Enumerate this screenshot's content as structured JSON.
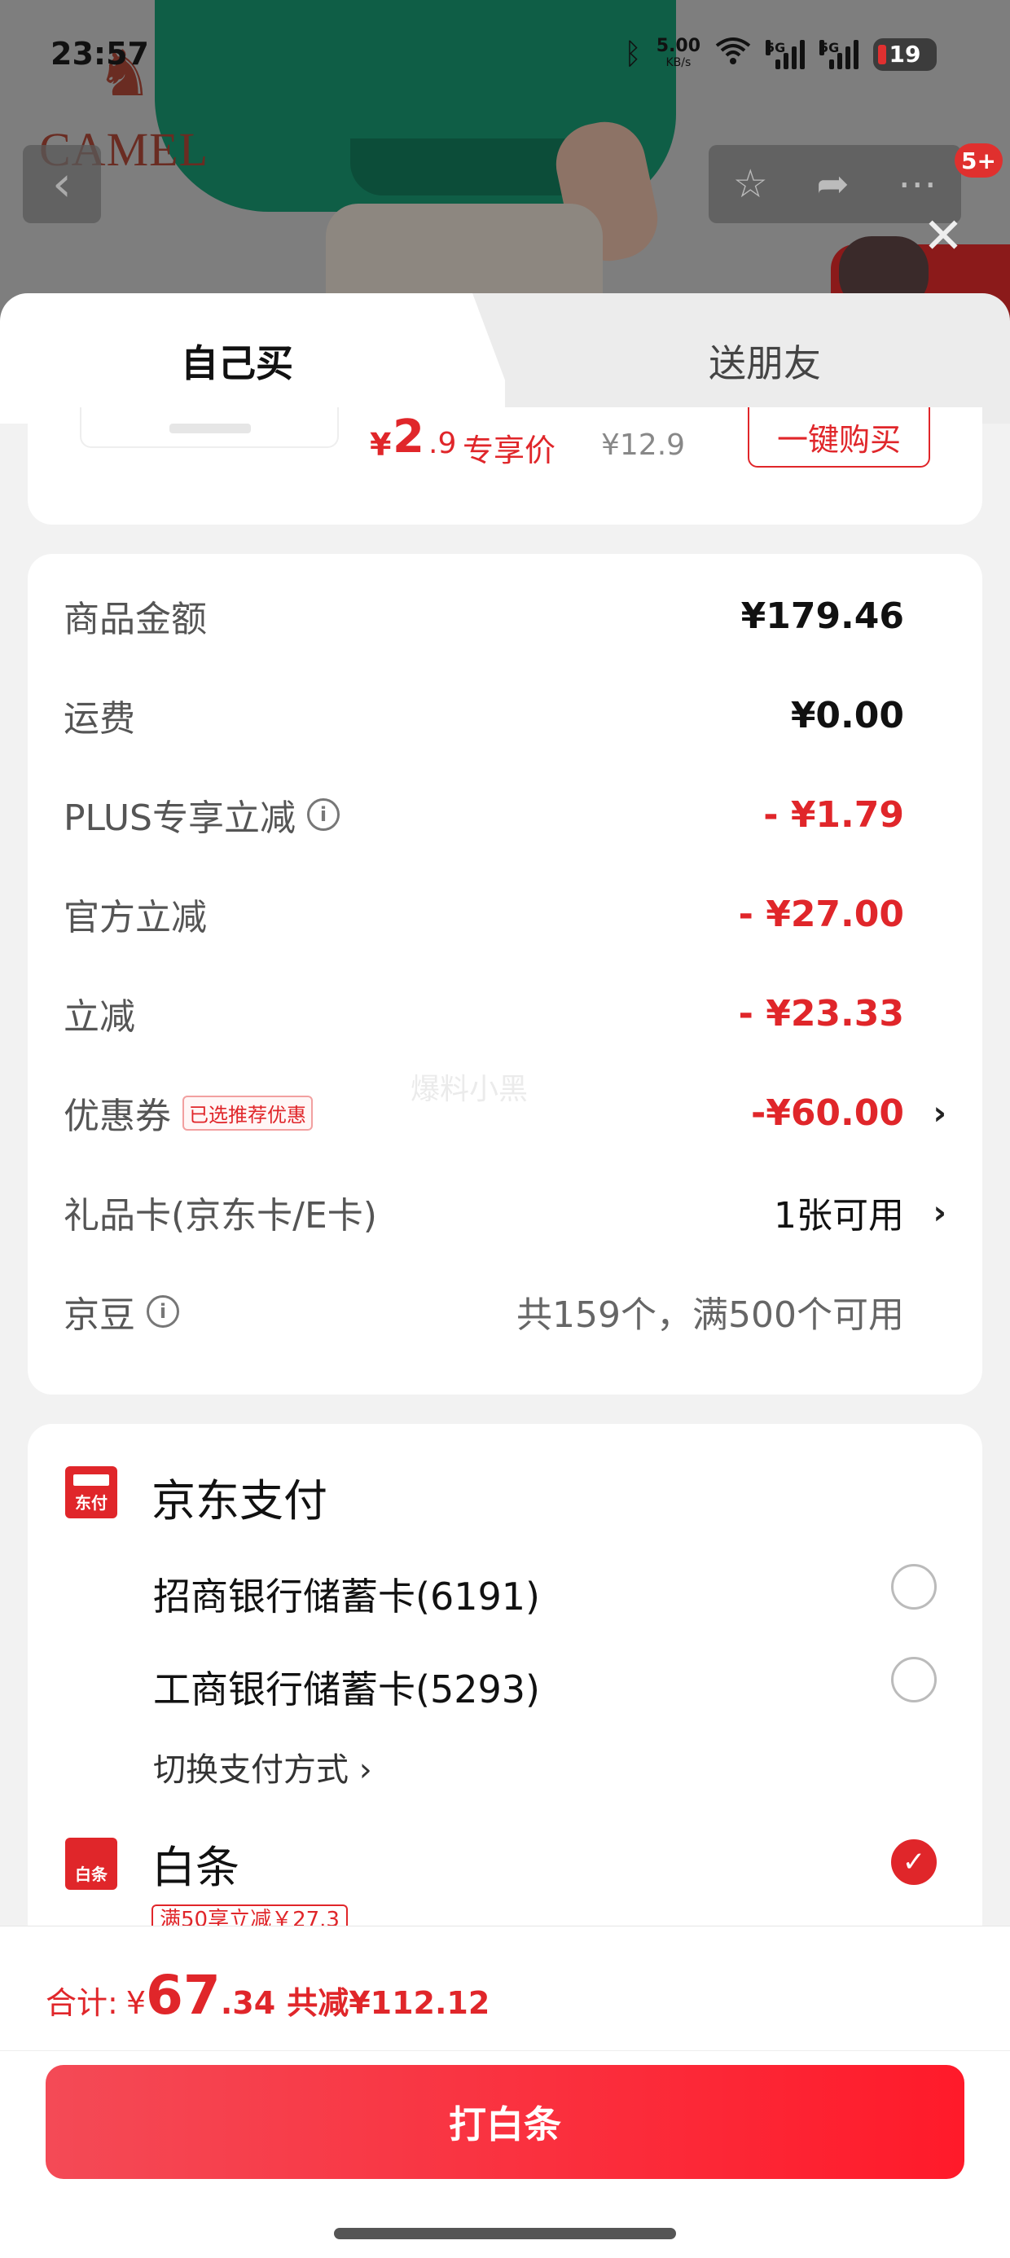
{
  "status_bar": {
    "time": "23:57",
    "network_speed": "5.00",
    "network_unit": "KB/s",
    "sim1": "5G",
    "sim2": "5G",
    "battery": "19"
  },
  "header": {
    "brand": "CAMEL",
    "cart_badge": "5+"
  },
  "tabs": [
    {
      "label": "自己买",
      "selected": true
    },
    {
      "label": "送朋友",
      "selected": false
    }
  ],
  "product_offer": {
    "currency": "¥",
    "price_int": "2",
    "price_dec": ".9",
    "price_tag": "专享价",
    "original_price": "¥12.9",
    "quick_buy": "一键购买"
  },
  "summary": {
    "rows": [
      {
        "label": "商品金额",
        "value": "¥179.46"
      },
      {
        "label": "运费",
        "value": "¥0.00"
      },
      {
        "label": "PLUS专享立减",
        "value": "- ¥1.79"
      },
      {
        "label": "官方立减",
        "value": "- ¥27.00"
      },
      {
        "label": "立减",
        "value": "- ¥23.33"
      },
      {
        "label": "优惠券",
        "tag": "已选推荐优惠",
        "value": "-¥60.00"
      },
      {
        "label": "礼品卡(京东卡/E卡)",
        "value": "1张可用"
      },
      {
        "label": "京豆",
        "value": "共159个，满500个可用"
      }
    ],
    "watermark": "爆料小黑"
  },
  "payment": {
    "jd_pay": {
      "title": "京东支付",
      "icon_text": "东付",
      "options": [
        {
          "label": "招商银行储蓄卡(6191)",
          "selected": false
        },
        {
          "label": "工商银行储蓄卡(5293)",
          "selected": false
        }
      ],
      "switch": "切换支付方式 ›"
    },
    "baitiao": {
      "title": "白条",
      "icon_text": "白条",
      "selected": true,
      "promo": "满50享立减￥27.3"
    }
  },
  "footer": {
    "total_label": "合计:",
    "currency": "¥",
    "total_int": "67",
    "total_dec": ".34",
    "savings": "共减¥112.12",
    "pay_button": "打白条"
  },
  "colors": {
    "accent_red": "#e0262a",
    "button_gradient_start": "#f44a56",
    "button_gradient_end": "#ff1a2a"
  },
  "icons": [
    "back-arrow-icon",
    "star-icon",
    "share-icon",
    "more-icon",
    "close-icon",
    "info-icon",
    "chevron-right-icon",
    "radio-icon",
    "check-icon",
    "bluetooth-icon",
    "wifi-icon"
  ]
}
